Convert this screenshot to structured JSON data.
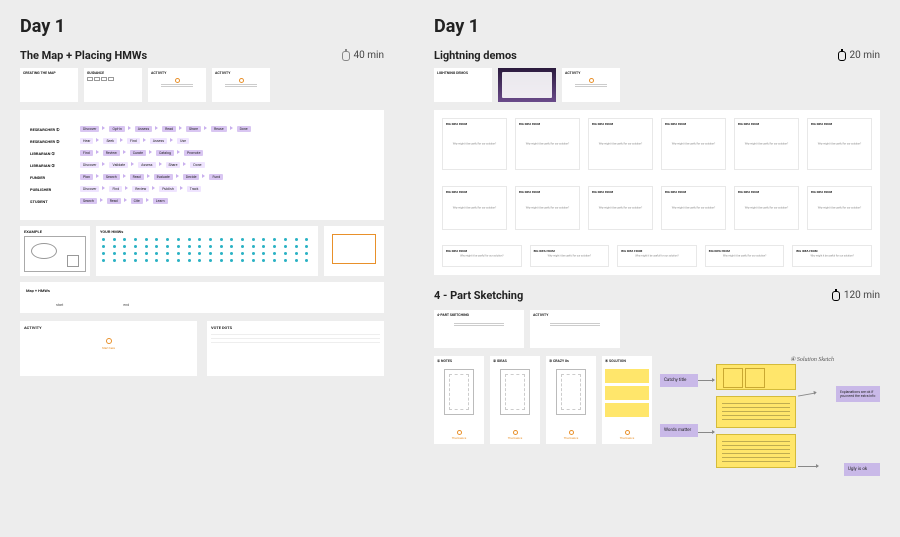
{
  "left": {
    "day_label": "Day 1",
    "section_title": "The Map + Placing HMWs",
    "duration": "40 min",
    "instruction_slides": [
      {
        "title": "CREATING THE MAP",
        "body": ""
      },
      {
        "title": "GUIDANCE",
        "body": "steps"
      },
      {
        "title": "ACTIVITY",
        "body": "timer"
      },
      {
        "title": "ACTIVITY",
        "body": "timer"
      }
    ],
    "map_rows": [
      {
        "label": "RESEARCHER ①",
        "steps": [
          "Discover",
          "Opt-in",
          "Assess",
          "Read",
          "Share",
          "Reuse",
          "Done"
        ]
      },
      {
        "label": "RESEARCHER ②",
        "steps": [
          "Hear",
          "Seek",
          "Find",
          "Assess",
          "Use"
        ]
      },
      {
        "label": "LIBRARIAN ①",
        "steps": [
          "Find",
          "Review",
          "Curate",
          "Catalog",
          "Promote"
        ]
      },
      {
        "label": "LIBRARIAN ②",
        "steps": [
          "Discover",
          "Validate",
          "Assess",
          "Share",
          "Done"
        ]
      },
      {
        "label": "FUNDER",
        "steps": [
          "Plan",
          "Search",
          "Read",
          "Evaluate",
          "Decide",
          "Fund"
        ]
      },
      {
        "label": "PUBLISHER",
        "steps": [
          "Discover",
          "Find",
          "Review",
          "Publish",
          "Track"
        ]
      },
      {
        "label": "STUDENT",
        "steps": [
          "Search",
          "Read",
          "Cite",
          "Learn"
        ]
      }
    ],
    "trio": {
      "drawn": "EXAMPLE",
      "dots": "YOUR HMWs",
      "blank": ""
    },
    "staging": {
      "title": "Map + HMWs",
      "left": "start",
      "right": "end"
    },
    "activity": {
      "title": "ACTIVITY",
      "caption": "Start here"
    },
    "voting": {
      "title": "VOTE DOTS"
    }
  },
  "right": {
    "day_label": "Day 1",
    "lightning": {
      "title": "Lightning demos",
      "duration": "20 min",
      "slides": [
        {
          "title": "LIGHTNING DEMOS"
        },
        {
          "title": "photo"
        },
        {
          "title": "ACTIVITY"
        }
      ],
      "grid_header": "BIG IDEA FROM",
      "grid_body": "Why might it be useful for our solution?"
    },
    "sketch": {
      "title": "4 - Part Sketching",
      "duration": "120 min",
      "slides": [
        {
          "title": "4-PART SKETCHING"
        },
        {
          "title": "ACTIVITY"
        }
      ],
      "cards": [
        {
          "title": "① NOTES",
          "caption": "The basics"
        },
        {
          "title": "② IDEAS",
          "caption": "The basics"
        },
        {
          "title": "③ CRAZY 8s",
          "caption": "The basics"
        },
        {
          "title": "④ SOLUTION",
          "caption": "The basics"
        }
      ],
      "solution": {
        "heading": "④ Solution Sketch",
        "posts": {
          "p1": "Catchy title",
          "p2": "Words matter",
          "p3": "Explanations are ok if you need the extra info",
          "p4": "Ugly is ok"
        }
      }
    }
  }
}
